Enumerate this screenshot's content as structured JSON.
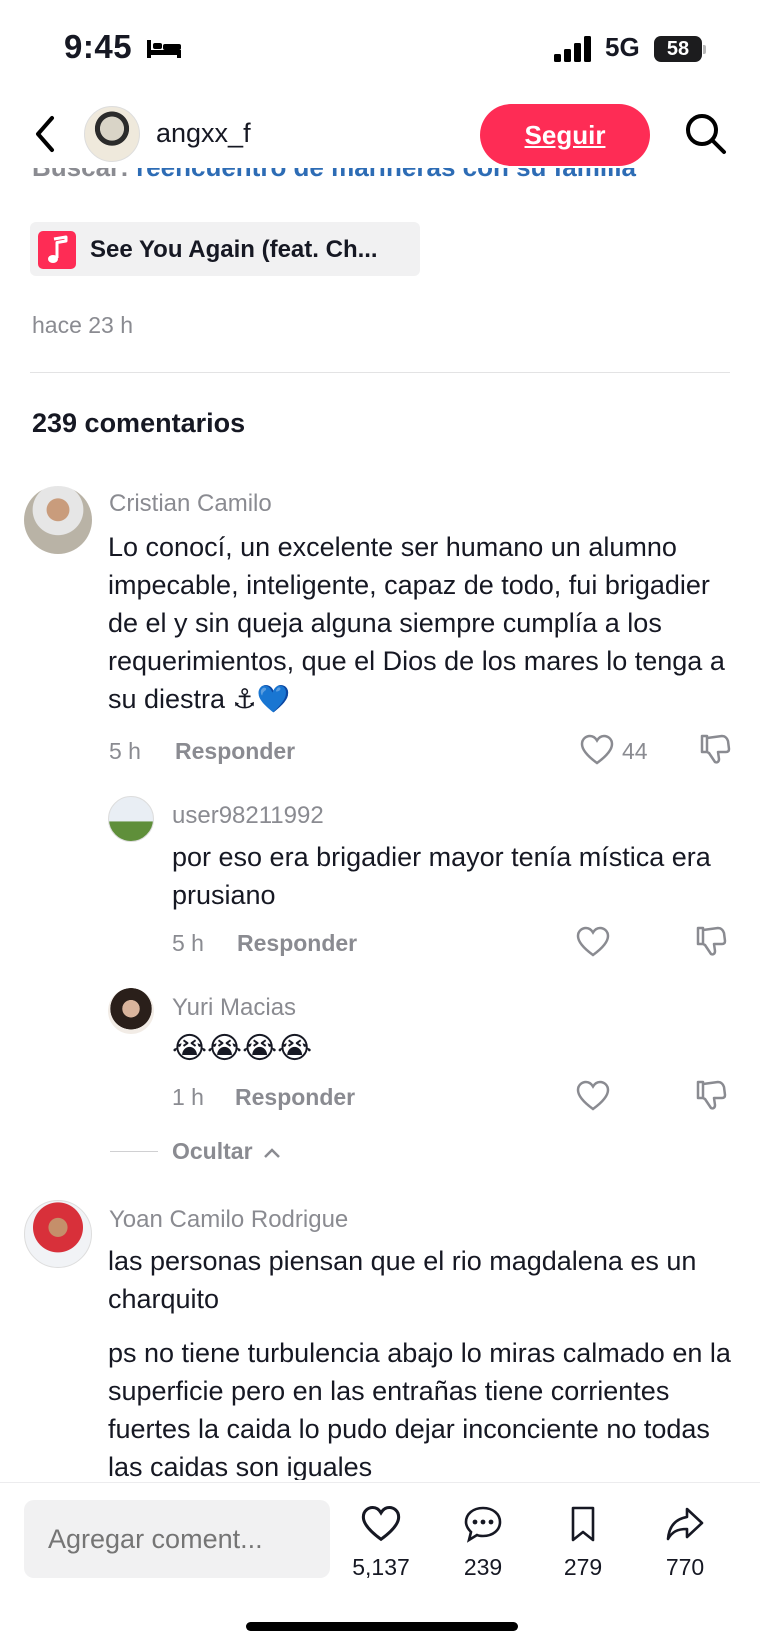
{
  "status_bar": {
    "time": "9:45",
    "network": "5G",
    "battery": "58"
  },
  "header": {
    "username": "angxx_f",
    "follow_label": "Seguir"
  },
  "caption": {
    "search_prefix": "Buscar:",
    "search_query": "reencuentro de marineras con su familia"
  },
  "music": {
    "title": "See You Again (feat. Ch..."
  },
  "post_time": "hace 23 h",
  "comments_count_label": "239 comentarios",
  "comments": [
    {
      "user": "Cristian Camilo",
      "text": "Lo conocí, un excelente ser humano un alumno impecable, inteligente, capaz de todo, fui brigadier de el y sin queja alguna siempre cumplía a los requerimientos, que el Dios de los mares lo tenga a su diestra ⚓💙",
      "time": "5 h",
      "reply_label": "Responder",
      "likes": "44"
    },
    {
      "user": "user98211992",
      "text": "por eso era brigadier mayor tenía mística era prusiano",
      "time": "5 h",
      "reply_label": "Responder",
      "likes": ""
    },
    {
      "user": "Yuri Macias",
      "text": "😭😭😭😭",
      "time": "1 h",
      "reply_label": "Responder",
      "likes": ""
    },
    {
      "user": "Yoan Camilo Rodrigue",
      "text": "las personas piensan que el rio magdalena es un charquito",
      "text2": "ps no tiene turbulencia abajo lo miras calmado en la superficie pero en las entrañas tiene corrientes fuertes la caida lo pudo dejar inconciente no todas las caidas son iguales"
    }
  ],
  "hide_label": "Ocultar",
  "bottom_bar": {
    "input_placeholder": "Agregar coment...",
    "likes": "5,137",
    "comments": "239",
    "saves": "279",
    "shares": "770"
  },
  "colors": {
    "accent": "#fe2c55",
    "muted": "#8a8b91",
    "link": "#2d6cb5"
  }
}
